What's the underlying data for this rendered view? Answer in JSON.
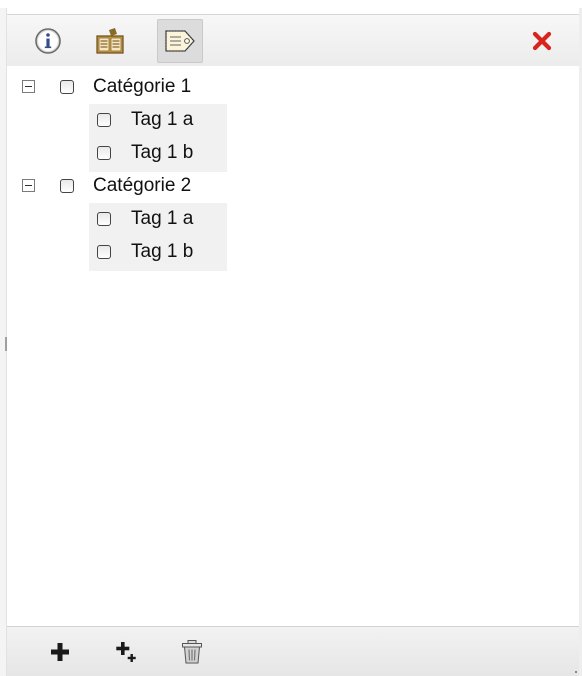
{
  "toolbar": {
    "info_icon": "info-icon",
    "edit_icon": "edit-book-icon",
    "tags_icon": "tag-icon",
    "close_icon": "close-icon",
    "accent_close": "#d8241c"
  },
  "tree": {
    "categories": [
      {
        "label": "Catégorie 1",
        "expanded": true,
        "checked": false,
        "tags": [
          {
            "label": "Tag 1 a",
            "checked": false
          },
          {
            "label": "Tag 1 b",
            "checked": false
          }
        ]
      },
      {
        "label": "Catégorie 2",
        "expanded": true,
        "checked": false,
        "tags": [
          {
            "label": "Tag 1 a",
            "checked": false
          },
          {
            "label": "Tag 1 b",
            "checked": false
          }
        ]
      }
    ]
  },
  "footer": {
    "add_icon": "plus-icon",
    "add_child_icon": "plus-sub-icon",
    "delete_icon": "trash-icon"
  }
}
